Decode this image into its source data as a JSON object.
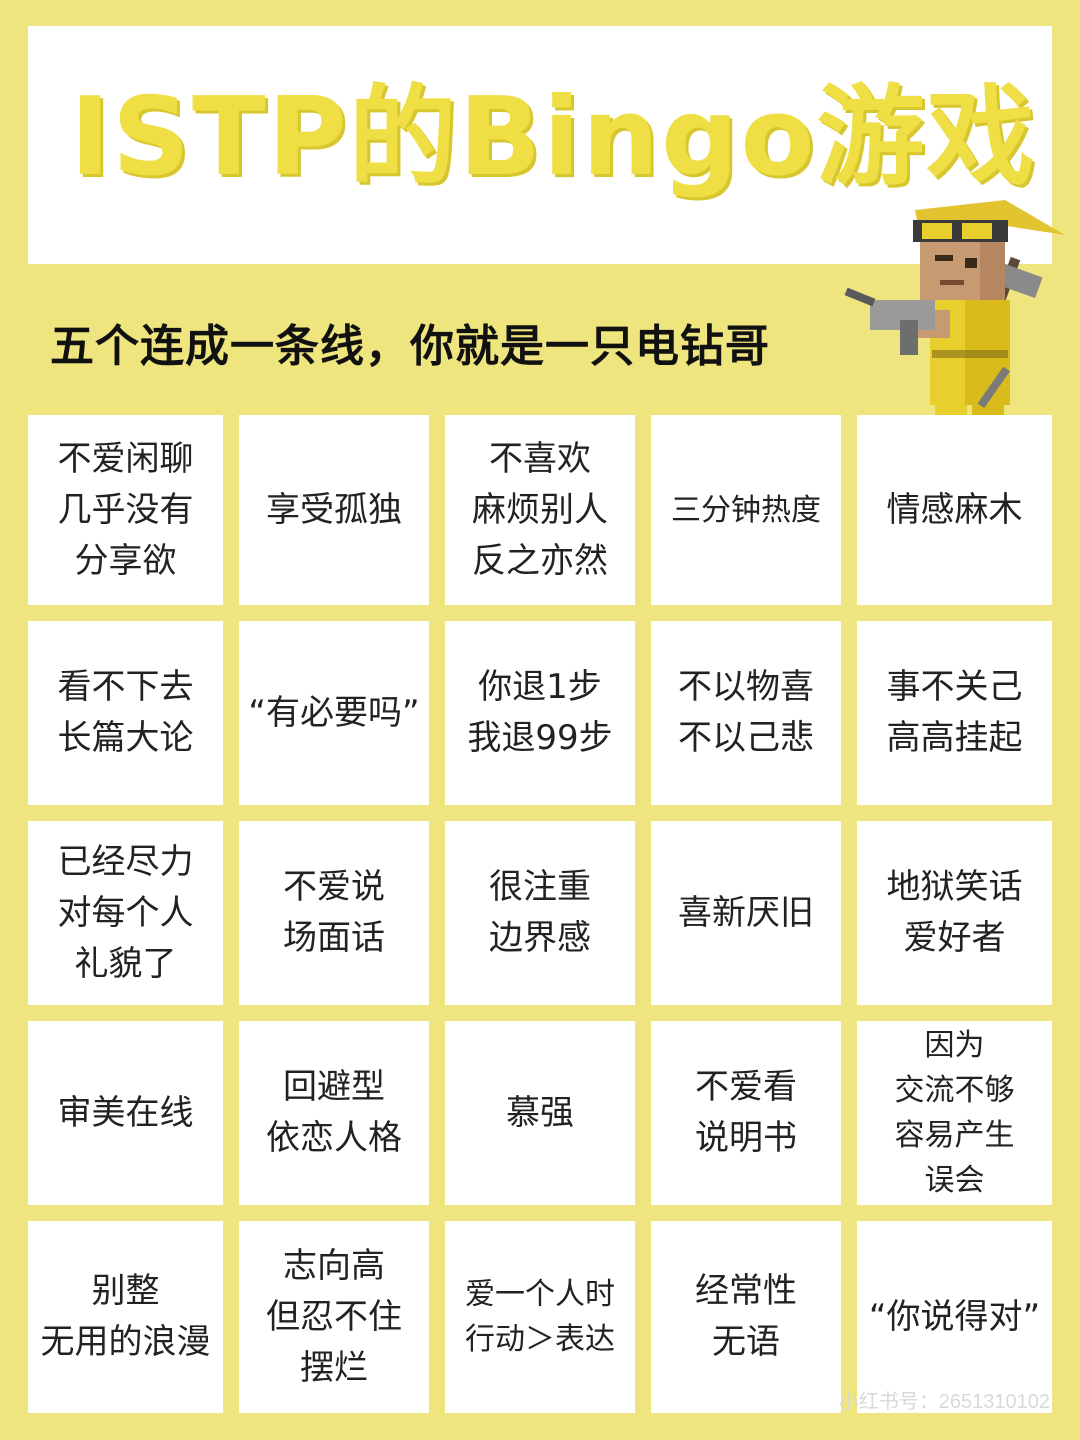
{
  "header": {
    "title": "ISTP的Bingo游戏",
    "subtitle": "五个连成一条线，你就是一只电钻哥"
  },
  "grid": {
    "cells": [
      "不爱闲聊\n几乎没有\n分享欲",
      "享受孤独",
      "不喜欢\n麻烦别人\n反之亦然",
      "三分钟热度",
      "情感麻木",
      "看不下去\n长篇大论",
      "“有必要吗”",
      "你退1步\n我退99步",
      "不以物喜\n不以己悲",
      "事不关己\n高高挂起",
      "已经尽力\n对每个人\n礼貌了",
      "不爱说\n场面话",
      "很注重\n边界感",
      "喜新厌旧",
      "地狱笑话\n爱好者",
      "审美在线",
      "回避型\n依恋人格",
      "慕强",
      "不爱看\n说明书",
      "因为\n交流不够\n容易产生\n误会",
      "别整\n无用的浪漫",
      "志向高\n但忍不住\n摆烂",
      "爱一个人时\n行动＞表达",
      "经常性\n无语",
      "“你说得对”"
    ]
  },
  "mascot": {
    "icon": "drill-worker-icon"
  },
  "watermark": "小红书号：2651310102",
  "colors": {
    "background": "#EFE57F",
    "title": "#EFDF45",
    "cell": "#FFFFFF"
  }
}
